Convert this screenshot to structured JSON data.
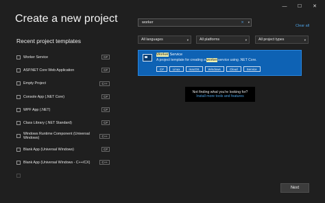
{
  "window": {
    "minimize": "—",
    "maximize": "☐",
    "close": "✕"
  },
  "page_title": "Create a new project",
  "recent": {
    "title": "Recent project templates",
    "items": [
      {
        "label": "Worker Service",
        "badge": "C#"
      },
      {
        "label": "ASP.NET Core Web Application",
        "badge": "C#"
      },
      {
        "label": "Empty Project",
        "badge": "C++"
      },
      {
        "label": "Console App (.NET Core)",
        "badge": "C#"
      },
      {
        "label": "WPF App (.NET)",
        "badge": "C#"
      },
      {
        "label": "Class Library (.NET Standard)",
        "badge": "C#"
      },
      {
        "label": "Windows Runtime Component (Universal Windows)",
        "badge": "C++"
      },
      {
        "label": "Blank App (Universal Windows)",
        "badge": "C#"
      },
      {
        "label": "Blank App (Universal Windows - C++/CX)",
        "badge": "C++"
      },
      {
        "label": "",
        "badge": ""
      }
    ]
  },
  "search": {
    "value": "worker",
    "clear_icon": "✕",
    "dropdown_icon": "▾"
  },
  "clear_all": "Clear all",
  "filters": {
    "languages": "All languages",
    "platforms": "All platforms",
    "project_types": "All project types"
  },
  "result": {
    "title_highlight": "Worker",
    "title_rest": " Service",
    "desc_before": "A project template for creating a ",
    "desc_highlight": "worker",
    "desc_after": " service using .NET Core.",
    "tags": [
      "C#",
      "Linux",
      "macOS",
      "Windows",
      "Cloud",
      "Service"
    ]
  },
  "not_found": {
    "text": "Not finding what you're looking for?",
    "link": "Install more tools and features"
  },
  "next_label": "Next"
}
